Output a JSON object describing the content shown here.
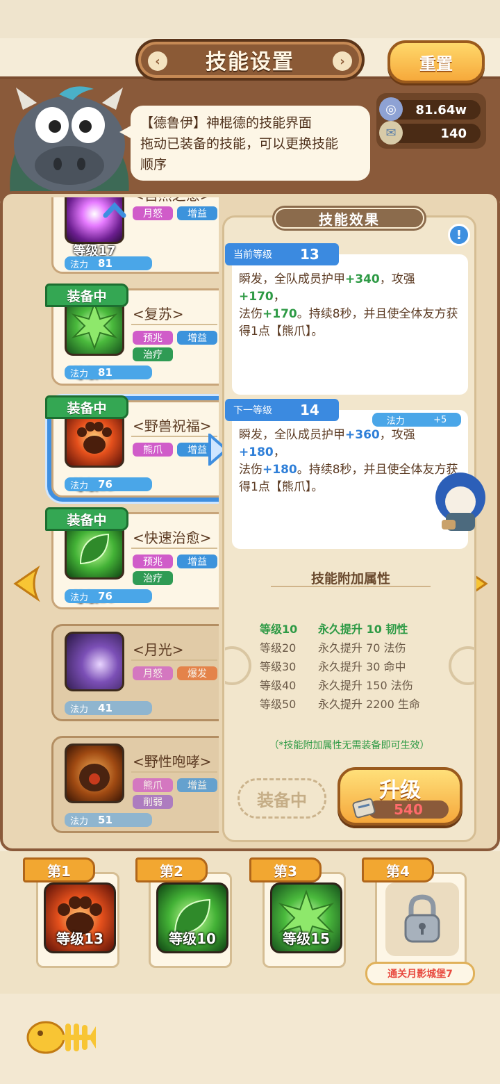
{
  "header": {
    "title": "技能设置",
    "reset_label": "重置"
  },
  "speech": {
    "text_line1": "【德鲁伊】神棍德的技能界面",
    "text_line2": "拖动已装备的技能，可以更换技能",
    "text_line3": "顺序"
  },
  "currency": {
    "gems": "81.64w",
    "scrolls": "140"
  },
  "skills": [
    {
      "name": "<自然之愈>",
      "level": "等级17",
      "mana_label": "法力",
      "mana": "81",
      "tags": [
        "月怒",
        "增益"
      ],
      "equipped": false,
      "state": "partial"
    },
    {
      "name": "<复苏>",
      "level": "等级15",
      "mana_label": "法力",
      "mana": "81",
      "tags": [
        "预兆",
        "增益",
        "治疗"
      ],
      "equipped": true,
      "equipped_label": "装备中"
    },
    {
      "name": "<野兽祝福>",
      "level": "等级13",
      "mana_label": "法力",
      "mana": "76",
      "tags": [
        "熊爪",
        "增益"
      ],
      "equipped": true,
      "equipped_label": "装备中",
      "selected": true
    },
    {
      "name": "<快速治愈>",
      "level": "等级10",
      "mana_label": "法力",
      "mana": "76",
      "tags": [
        "预兆",
        "增益",
        "治疗"
      ],
      "equipped": true,
      "equipped_label": "装备中"
    },
    {
      "name": "<月光>",
      "level": "",
      "mana_label": "法力",
      "mana": "41",
      "tags": [
        "月怒",
        "爆发"
      ],
      "equipped": false,
      "locked": true
    },
    {
      "name": "<野性咆哮>",
      "level": "",
      "mana_label": "法力",
      "mana": "51",
      "tags": [
        "熊爪",
        "增益",
        "削弱"
      ],
      "equipped": false,
      "locked": true
    }
  ],
  "detail": {
    "title": "技能效果",
    "current": {
      "label": "当前等级",
      "level": "13",
      "line1_a": "瞬发，全队成员护甲",
      "line1_b": "+340",
      "line1_c": "，攻强",
      "line1_d": "+170",
      "line1_e": "，",
      "line2_a": "法伤",
      "line2_b": "+170",
      "line2_c": "。持续8秒，并且使全体友方获",
      "line3": "得1点【熊爪】。"
    },
    "next": {
      "label": "下一等级",
      "level": "14",
      "mana_label": "法力",
      "mana_delta": "+5",
      "line1_a": "瞬发，全队成员护甲",
      "line1_b": "+360",
      "line1_c": "，攻强",
      "line1_d": "+180",
      "line1_e": "，",
      "line2_a": "法伤",
      "line2_b": "+180",
      "line2_c": "。持续8秒，并且使全体友方获",
      "line3": "得1点【熊爪】。"
    },
    "attr_title": "技能附加属性",
    "attrs": [
      {
        "level": "等级10",
        "effect": "永久提升 10 韧性",
        "active": true
      },
      {
        "level": "等级20",
        "effect": "永久提升 70 法伤",
        "active": false
      },
      {
        "level": "等级30",
        "effect": "永久提升 30 命中",
        "active": false
      },
      {
        "level": "等级40",
        "effect": "永久提升 150 法伤",
        "active": false
      },
      {
        "level": "等级50",
        "effect": "永久提升 2200 生命",
        "active": false
      }
    ],
    "attr_note": "（*技能附加属性无需装备即可生效）",
    "equip_state": "装备中",
    "upgrade_label": "升级",
    "upgrade_cost": "540"
  },
  "slots": [
    {
      "label": "第1",
      "level": "等级13"
    },
    {
      "label": "第2",
      "level": "等级10"
    },
    {
      "label": "第3",
      "level": "等级15"
    },
    {
      "label": "第4",
      "level": "",
      "locked": true,
      "unlock_tip": "通关月影城堡7"
    }
  ],
  "colors": {
    "accent_blue": "#3f8fe0",
    "equipped_green": "#34a753",
    "button_orange": "#f6a93b",
    "frame_brown": "#8a5a3a"
  }
}
